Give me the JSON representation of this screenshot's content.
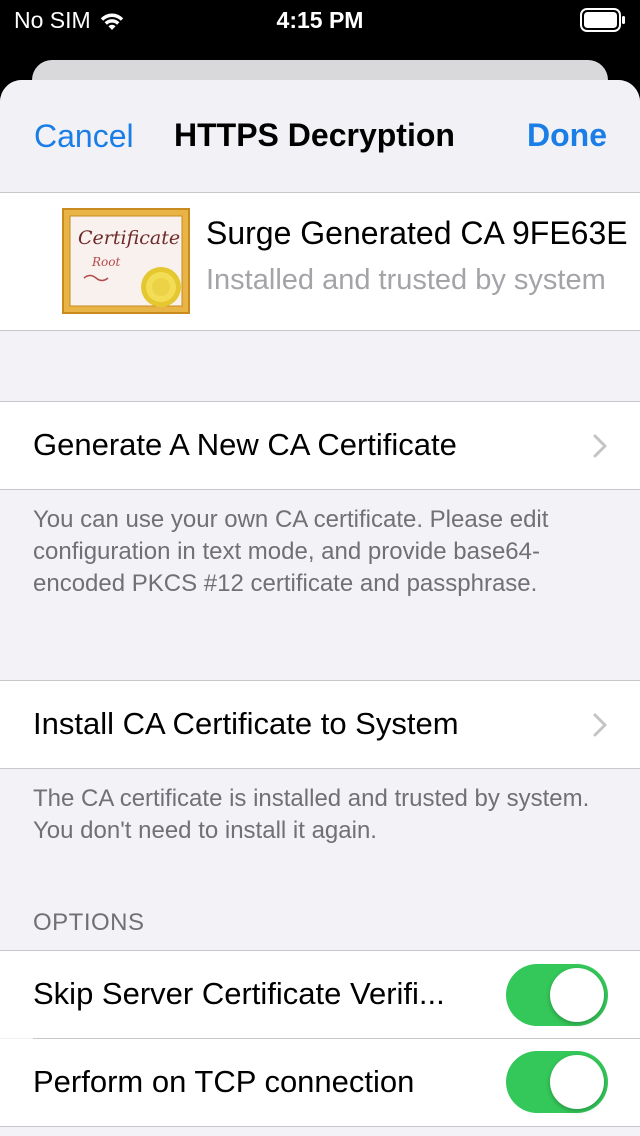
{
  "status_bar": {
    "carrier": "No SIM",
    "time": "4:15 PM"
  },
  "nav": {
    "cancel_label": "Cancel",
    "title": "HTTPS Decryption",
    "done_label": "Done"
  },
  "certificate": {
    "title": "Surge Generated CA 9FE63E",
    "subtitle": "Installed and trusted by system",
    "icon_text": "Certificate",
    "icon_subtext": "Root"
  },
  "generate_cell": {
    "label": "Generate A New CA Certificate",
    "footer": "You can use your own CA certificate. Please edit configuration in text mode, and provide base64-encoded PKCS #12 certificate and passphrase."
  },
  "install_cell": {
    "label": "Install CA Certificate to System",
    "footer": "The CA certificate is installed and trusted by system. You don't need to install it again."
  },
  "options": {
    "header": "OPTIONS",
    "items": [
      {
        "label": "Skip Server Certificate Verifi...",
        "enabled": true
      },
      {
        "label": "Perform on TCP connection",
        "enabled": true
      }
    ]
  },
  "colors": {
    "accent": "#1a7ee6",
    "toggle_on": "#34c759",
    "group_background": "#f2f2f7",
    "secondary_text": "#707075"
  },
  "icons": [
    "wifi-icon",
    "battery-icon",
    "certificate-icon",
    "chevron-right-icon"
  ]
}
